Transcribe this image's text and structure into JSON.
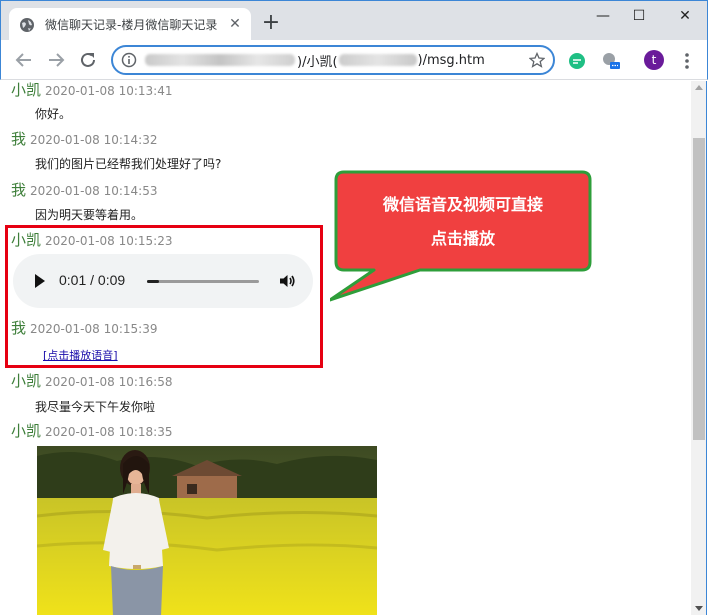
{
  "browser": {
    "tab_title": "微信聊天记录-楼月微信聊天记录",
    "url_visible_part_1": ")/小凯(",
    "url_visible_part_2": ")/msg.htm",
    "profile_initial": "t",
    "accent_color": "#3c86d6"
  },
  "messages": [
    {
      "sender": "小凯",
      "time": "2020-01-08 10:13:41",
      "text": "你好。"
    },
    {
      "sender": "我",
      "time": "2020-01-08 10:14:32",
      "text": "我们的图片已经帮我们处理好了吗?"
    },
    {
      "sender": "我",
      "time": "2020-01-08 10:14:53",
      "text": "因为明天要等着用。"
    },
    {
      "sender": "小凯",
      "time": "2020-01-08 10:15:23",
      "audio": {
        "current": "0:01",
        "separator": "/",
        "duration": "0:09",
        "progress": 0.11
      }
    },
    {
      "sender": "我",
      "time": "2020-01-08 10:15:39",
      "link": "[点击播放语音]"
    },
    {
      "sender": "小凯",
      "time": "2020-01-08 10:16:58",
      "text": "我尽量今天下午发你啦"
    },
    {
      "sender": "小凯",
      "time": "2020-01-08 10:18:35",
      "image": "photo-girl-in-yellow-field"
    }
  ],
  "annotation": {
    "callout_line_1": "微信语音及视频可直接",
    "callout_line_2": "点击播放",
    "callout_fill": "#f04040",
    "callout_border": "#2e9e3a",
    "box_color": "#e60012"
  },
  "colors": {
    "sender": "#3e7f3a",
    "time": "#888888",
    "link": "#1a0dab"
  }
}
